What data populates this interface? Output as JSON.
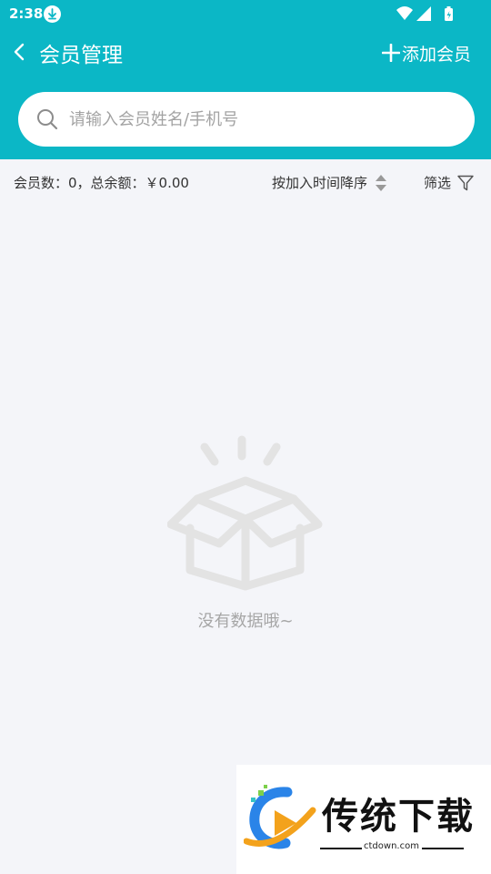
{
  "status_bar": {
    "time": "2:38",
    "download_icon": "download-icon",
    "wifi_icon": "wifi-icon",
    "signal_icon": "signal-icon",
    "battery_icon": "battery-icon"
  },
  "nav": {
    "title": "会员管理",
    "back_icon": "chevron-left-icon",
    "add_label": "添加会员",
    "add_icon": "plus-icon"
  },
  "search": {
    "placeholder": "请输入会员姓名/手机号",
    "value": "",
    "icon": "search-icon"
  },
  "filter_bar": {
    "summary": "会员数：0，总余额：￥0.00",
    "sort_label": "按加入时间降序",
    "sort_icon": "sort-arrows-icon",
    "filter_label": "筛选",
    "filter_icon": "funnel-icon"
  },
  "empty_state": {
    "icon": "empty-box-icon",
    "text": "没有数据哦~"
  },
  "watermark": {
    "title": "传统下载",
    "url": "ctdown.com"
  },
  "colors": {
    "header": "#0bb7c6",
    "background": "#f4f5f9",
    "muted_text": "#a6a6a6",
    "empty_icon": "#e3e3e3"
  }
}
